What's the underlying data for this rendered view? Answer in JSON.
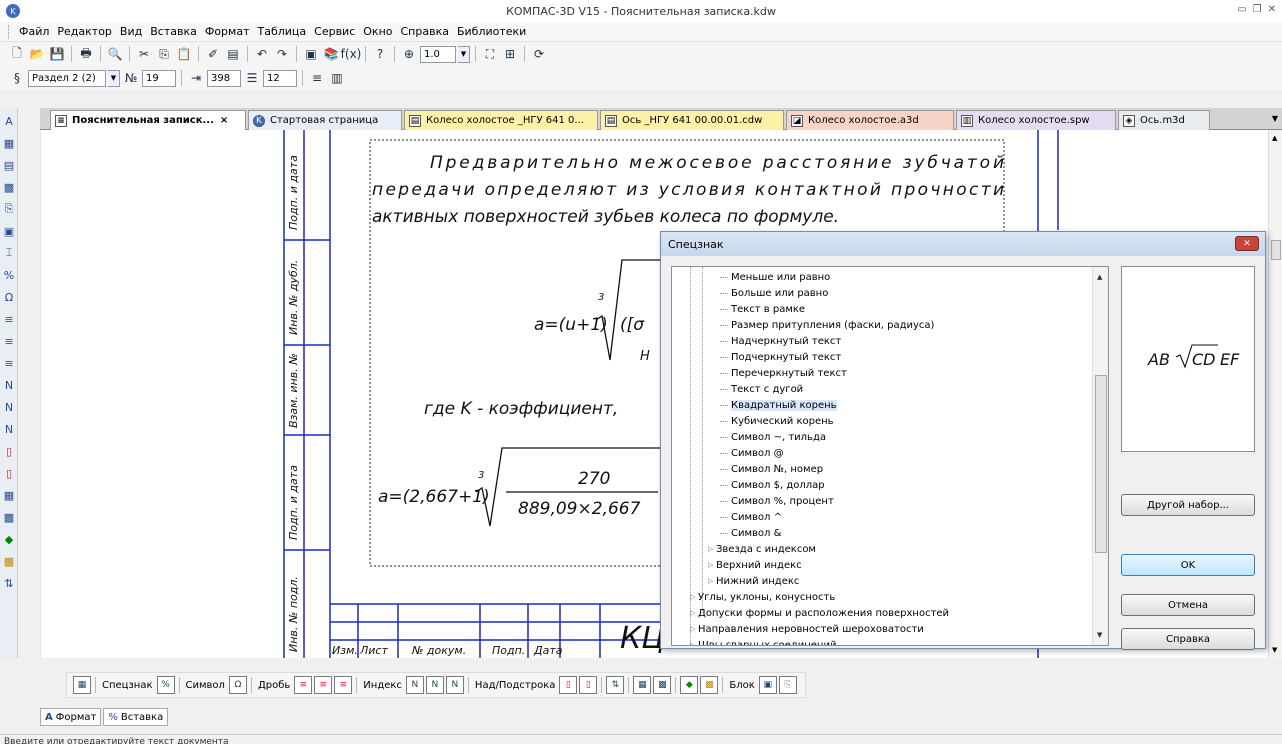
{
  "window": {
    "title": "КОМПАС-3D V15 - Пояснительная записка.kdw"
  },
  "menu": [
    "Файл",
    "Редактор",
    "Вид",
    "Вставка",
    "Формат",
    "Таблица",
    "Сервис",
    "Окно",
    "Справка",
    "Библиотеки"
  ],
  "toolbar": {
    "zoom_value": "1.0",
    "section_value": "Раздел 2 (2)",
    "field_19": "19",
    "field_398": "398",
    "field_12": "12"
  },
  "tabs": [
    {
      "label": "Пояснительная записк...",
      "close": "×"
    },
    {
      "label": "Стартовая страница"
    },
    {
      "label": "Колесо холостое _НГУ 641 0..."
    },
    {
      "label": "Ось _НГУ 641 00.00.01.cdw"
    },
    {
      "label": "Колесо холостое.a3d"
    },
    {
      "label": "Колесо холостое.spw"
    },
    {
      "label": "Ось.m3d"
    }
  ],
  "document": {
    "para_line1": "Предварительно   межосевое   расстояние   зубчатой",
    "para_line2": "передачи   определяют   из   условия   контактной   прочности",
    "para_line3": "активных поверхностей зубьев колеса по формуле.",
    "formula1": "a=(u+1)",
    "formula1_exp": "3",
    "formula1_frag": "([σ",
    "formula1_sub": "H",
    "where_text": "где K - коэффициент, ",
    "formula2": "a=(2,667+1)",
    "formula2_exp": "3",
    "formula2_num": "270",
    "formula2_den": "889,09×2,667",
    "stamp_text": "КЦ",
    "side_labels": [
      "Подп. и дата",
      "Инв. № дубл.",
      "Взам. инв. №",
      "Подп. и дата",
      "Инв. № подл."
    ],
    "table_headers": [
      "Изм.",
      "Лист",
      "№ докум.",
      "Подп.",
      "Дата"
    ]
  },
  "dialog": {
    "title": "Спецзнак",
    "close": "✕",
    "tree_items": [
      {
        "label": "Меньше или равно",
        "level": 2
      },
      {
        "label": "Больше или равно",
        "level": 2
      },
      {
        "label": "Текст в рамке",
        "level": 2
      },
      {
        "label": "Размер притупления (фаски, радиуса)",
        "level": 2
      },
      {
        "label": "Надчеркнутый текст",
        "level": 2
      },
      {
        "label": "Подчеркнутый текст",
        "level": 2
      },
      {
        "label": "Перечеркнутый текст",
        "level": 2
      },
      {
        "label": "Текст с дугой",
        "level": 2
      },
      {
        "label": "Квадратный корень",
        "level": 2,
        "selected": true
      },
      {
        "label": "Кубический корень",
        "level": 2
      },
      {
        "label": "Символ ~, тильда",
        "level": 2
      },
      {
        "label": "Символ @",
        "level": 2
      },
      {
        "label": "Символ №, номер",
        "level": 2
      },
      {
        "label": "Символ $, доллар",
        "level": 2
      },
      {
        "label": "Символ %, процент",
        "level": 2
      },
      {
        "label": "Символ ^",
        "level": 2
      },
      {
        "label": "Символ &",
        "level": 2
      },
      {
        "label": "Звезда с индексом",
        "level": 1,
        "expandable": true
      },
      {
        "label": "Верхний индекс",
        "level": 1,
        "expandable": true
      },
      {
        "label": "Нижний индекс",
        "level": 1,
        "expandable": true
      },
      {
        "label": "Углы, уклоны, конусность",
        "level": 0,
        "expandable": true
      },
      {
        "label": "Допуски формы и расположения поверхностей",
        "level": 0,
        "expandable": true
      },
      {
        "label": "Направления неровностей шероховатости",
        "level": 0,
        "expandable": true
      },
      {
        "label": "Швы сварных соединений",
        "level": 0,
        "expandable": true
      }
    ],
    "preview_text": "AB",
    "preview_root": "CD",
    "preview_tail": "EF",
    "btn_other": "Другой набор...",
    "btn_ok": "OK",
    "btn_cancel": "Отмена",
    "btn_help": "Справка"
  },
  "format_toolbar": {
    "spec": "Спецзнак",
    "symbol": "Символ",
    "fraction": "Дробь",
    "index": "Индекс",
    "overunder": "Над/Подстрока",
    "block": "Блок"
  },
  "subtabs": {
    "format": "Формат",
    "insert": "Вставка"
  },
  "status": {
    "text": "Введите или отредактируйте текст документа"
  }
}
